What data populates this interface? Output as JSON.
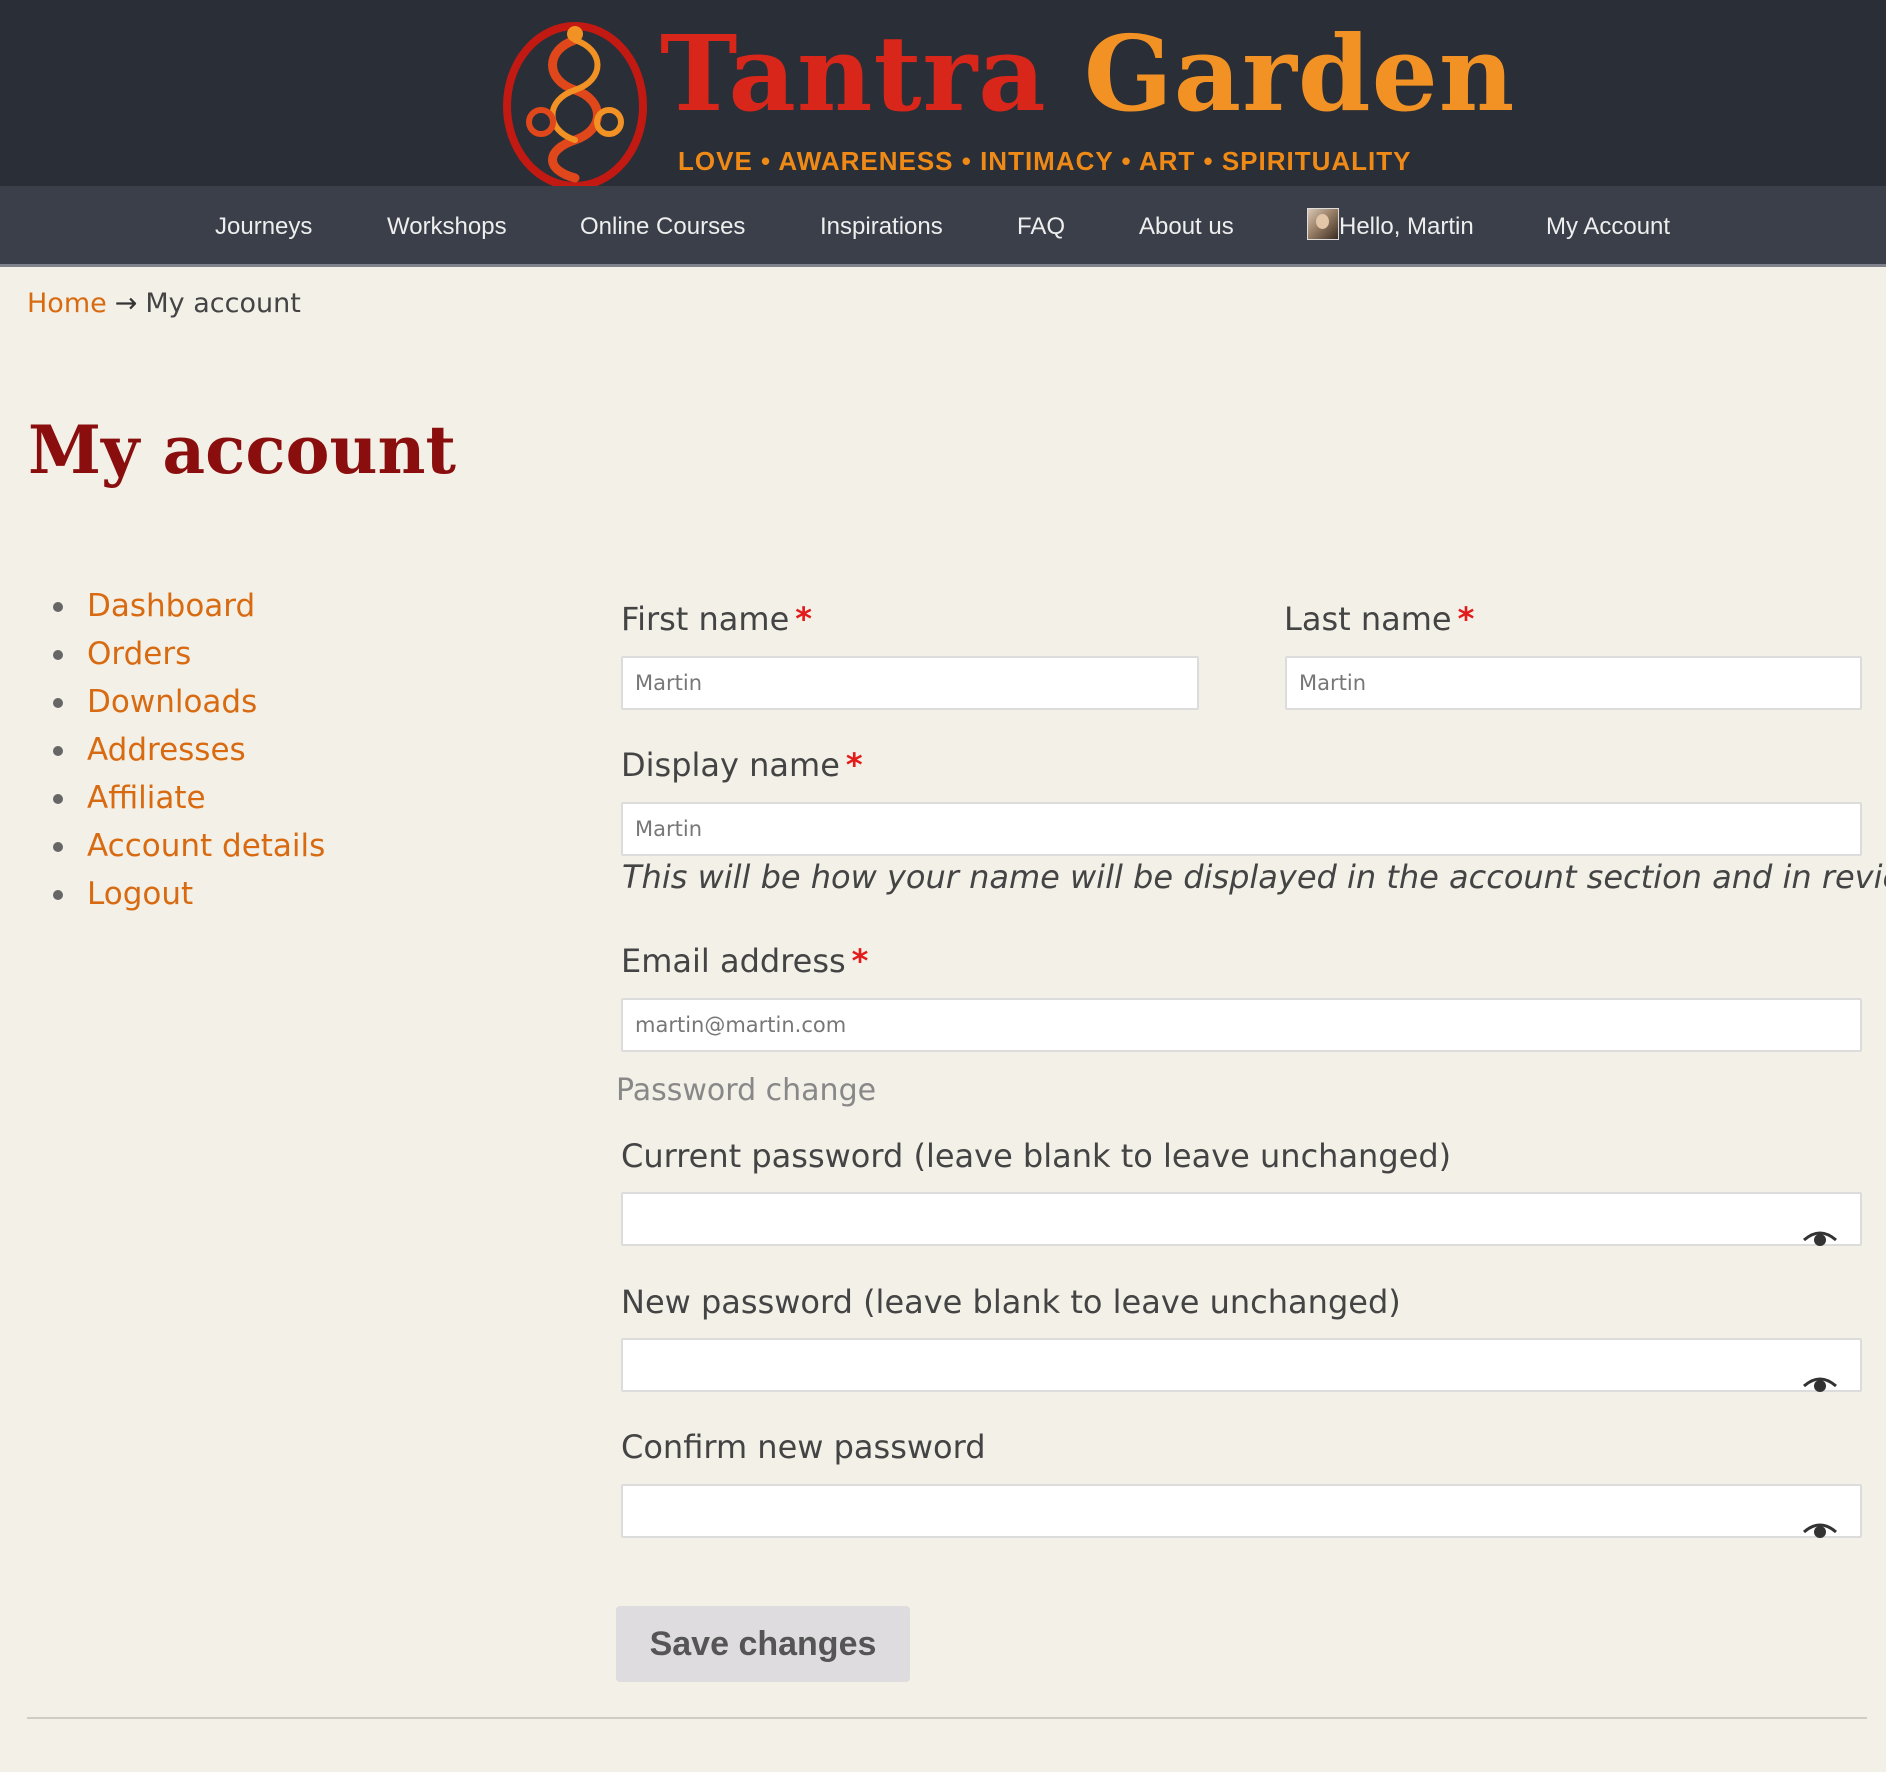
{
  "brand": {
    "title_part1": "Tantra",
    "title_part2": "Garden",
    "tagline": "LOVE • AWARENESS • INTIMACY • ART • SPIRITUALITY",
    "primary_color": "#d9261a",
    "secondary_color": "#f29124"
  },
  "nav": {
    "items": [
      {
        "label": "Journeys"
      },
      {
        "label": "Workshops"
      },
      {
        "label": "Online Courses"
      },
      {
        "label": "Inspirations"
      },
      {
        "label": "FAQ"
      },
      {
        "label": "About us"
      },
      {
        "label": "Hello, Martin",
        "icon": "avatar"
      },
      {
        "label": "My Account"
      }
    ]
  },
  "breadcrumb": {
    "home": "Home",
    "separator": "→",
    "current": "My account"
  },
  "page": {
    "title": "My account"
  },
  "sidebar": {
    "items": [
      {
        "label": "Dashboard"
      },
      {
        "label": "Orders"
      },
      {
        "label": "Downloads"
      },
      {
        "label": "Addresses"
      },
      {
        "label": "Affiliate"
      },
      {
        "label": "Account details"
      },
      {
        "label": "Logout"
      }
    ]
  },
  "form": {
    "required_mark": "*",
    "first_name": {
      "label": "First name",
      "value": "Martin"
    },
    "last_name": {
      "label": "Last name",
      "value": "Martin"
    },
    "display_name": {
      "label": "Display name",
      "value": "Martin",
      "hint": "This will be how your name will be displayed in the account section and in reviews"
    },
    "email": {
      "label": "Email address",
      "value": "martin@martin.com"
    },
    "password_section": "Password change",
    "current_password": {
      "label": "Current password (leave blank to leave unchanged)",
      "value": ""
    },
    "new_password": {
      "label": "New password (leave blank to leave unchanged)",
      "value": ""
    },
    "confirm_password": {
      "label": "Confirm new password",
      "value": ""
    },
    "save_label": "Save changes"
  },
  "colors": {
    "header_bg": "#2a2e37",
    "nav_bg": "#3b3f49",
    "link": "#d86b12",
    "title": "#8a0e0e",
    "required": "#e21b1b",
    "page_bg": "#f3f0e7"
  }
}
